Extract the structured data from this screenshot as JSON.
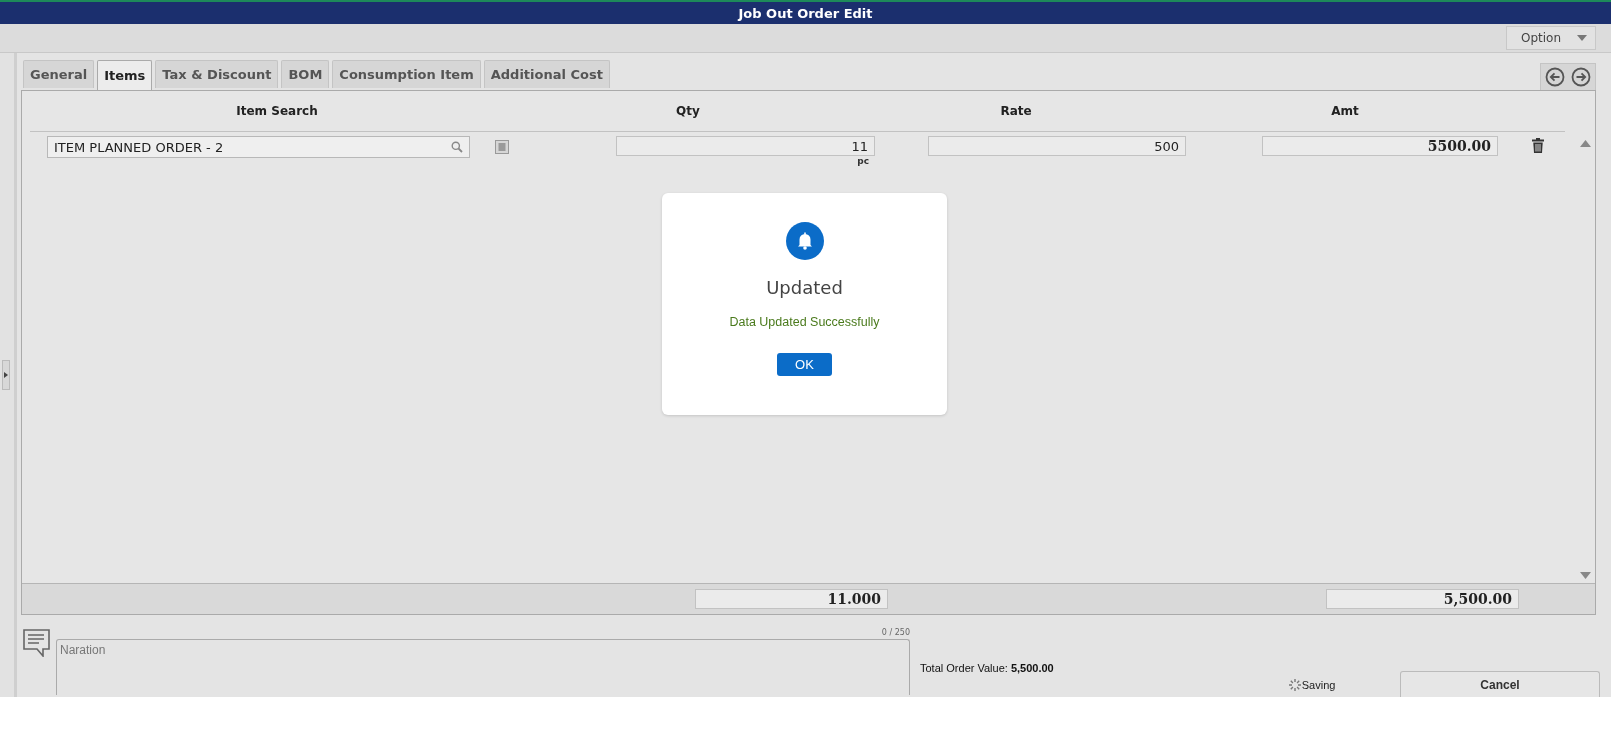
{
  "window": {
    "title": "Job Out Order Edit"
  },
  "toolbar": {
    "option_button": "Option"
  },
  "tabs": [
    {
      "label": "General",
      "selected": false
    },
    {
      "label": "Items",
      "selected": true
    },
    {
      "label": "Tax & Discount",
      "selected": false
    },
    {
      "label": "BOM",
      "selected": false
    },
    {
      "label": "Consumption Item",
      "selected": false
    },
    {
      "label": "Additional Cost",
      "selected": false
    }
  ],
  "table": {
    "columns": [
      "Item Search",
      "Qty",
      "Rate",
      "Amt"
    ],
    "rows": [
      {
        "item": "ITEM PLANNED ORDER - 2",
        "qty": "11",
        "unit": "pc",
        "rate": "500",
        "amt": "5500.00"
      }
    ],
    "totals": {
      "qty": "11.000",
      "amt": "5,500.00"
    }
  },
  "narration": {
    "placeholder": "Naration",
    "counter": "0 / 250"
  },
  "summary": {
    "label": "Total Order Value:",
    "value": "5,500.00"
  },
  "status": "Saving",
  "cancel_button": "Cancel",
  "dialog": {
    "title": "Updated",
    "message": "Data Updated Successfully",
    "button": "OK"
  }
}
